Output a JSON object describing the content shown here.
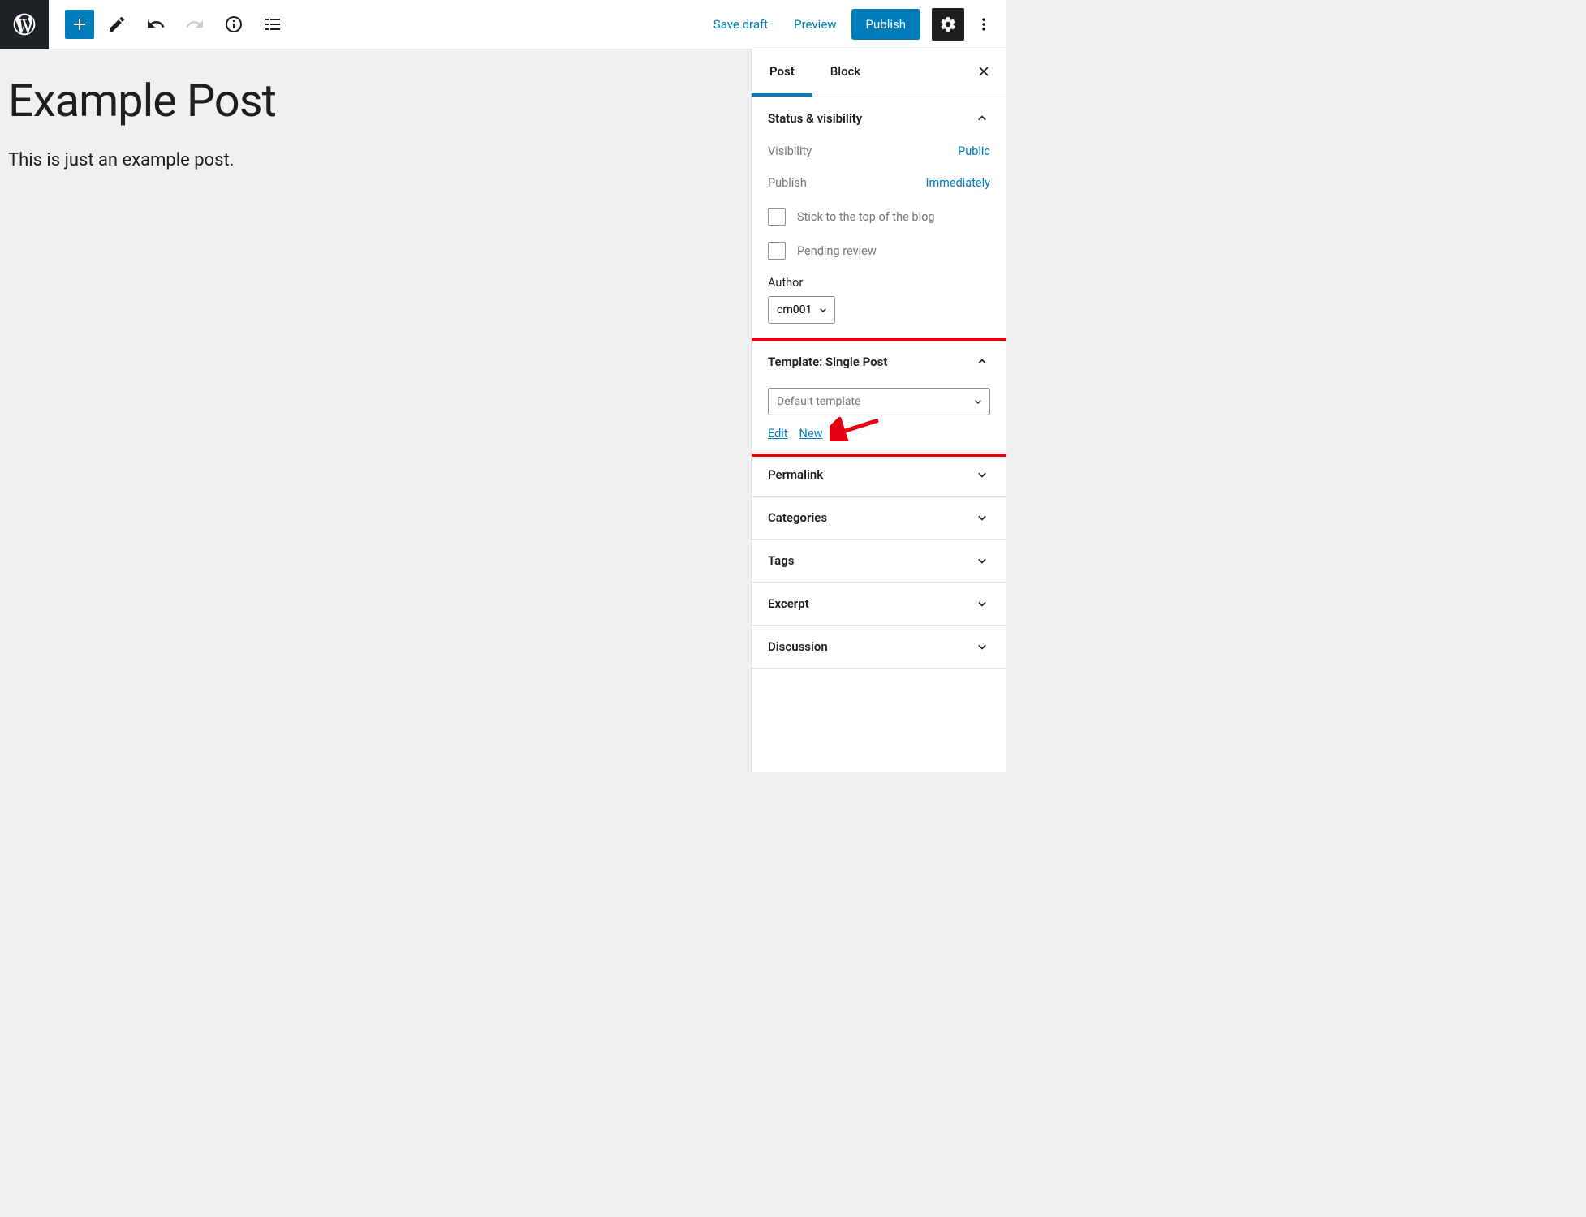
{
  "toolbar": {
    "save_draft": "Save draft",
    "preview": "Preview",
    "publish": "Publish"
  },
  "editor": {
    "title": "Example Post",
    "body": "This is just an example post."
  },
  "sidebar": {
    "tabs": {
      "post": "Post",
      "block": "Block"
    },
    "status": {
      "heading": "Status & visibility",
      "visibility_label": "Visibility",
      "visibility_value": "Public",
      "publish_label": "Publish",
      "publish_value": "Immediately",
      "sticky_label": "Stick to the top of the blog",
      "pending_label": "Pending review",
      "author_label": "Author",
      "author_value": "crn001"
    },
    "template": {
      "heading": "Template: Single Post",
      "select_value": "Default template",
      "edit": "Edit",
      "new": "New"
    },
    "panels": {
      "permalink": "Permalink",
      "categories": "Categories",
      "tags": "Tags",
      "excerpt": "Excerpt",
      "discussion": "Discussion"
    }
  }
}
